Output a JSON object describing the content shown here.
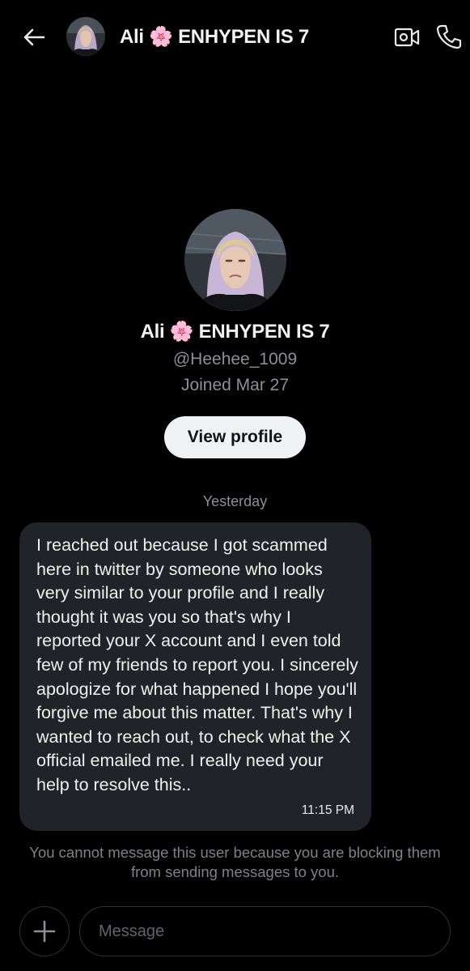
{
  "header": {
    "back_icon": "arrow-left-icon",
    "title": "Ali 🌸 ENHYPEN IS 7",
    "video_icon": "video-call-icon",
    "call_icon": "phone-icon"
  },
  "profile": {
    "name": "Ali 🌸 ENHYPEN IS 7",
    "handle": "@Heehee_1009",
    "joined": "Joined Mar 27",
    "view_profile_label": "View profile"
  },
  "conversation": {
    "date_separator": "Yesterday",
    "messages": [
      {
        "text": "I reached out because I got scammed here in twitter by someone who looks very similar to your profile and I really thought it was you so that's why I reported your X account and I even told few of my friends to report you. I sincerely apologize for what happened I hope you'll forgive me about this matter. That's why I wanted to reach out, to check what the X official emailed me. I really need your help to resolve this..",
        "time": "11:15 PM"
      }
    ],
    "blocked_notice": "You cannot message this user because you are blocking them from sending messages to you."
  },
  "composer": {
    "add_icon": "plus-icon",
    "placeholder": "Message"
  },
  "colors": {
    "background": "#000000",
    "bubble": "#202327",
    "muted_text": "#8b9094",
    "button_bg": "#eff3f4"
  }
}
